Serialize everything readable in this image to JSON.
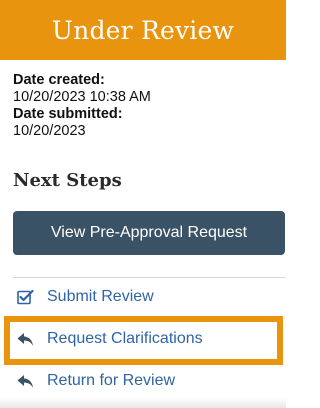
{
  "status": {
    "title": "Under Review",
    "color": "#e8940e"
  },
  "dates": {
    "created_label": "Date created:",
    "created_value": "10/20/2023 10:38 AM",
    "submitted_label": "Date submitted:",
    "submitted_value": "10/20/2023"
  },
  "next_steps": {
    "heading": "Next Steps",
    "primary_button_label": "View Pre-Approval Request",
    "primary_button_color": "#3a5265"
  },
  "actions": [
    {
      "label": "Submit Review",
      "icon": "checkbox-edit-icon"
    },
    {
      "label": "Request Clarifications",
      "icon": "reply-arrow-icon",
      "highlighted": true
    },
    {
      "label": "Return for Review",
      "icon": "reply-arrow-icon"
    }
  ],
  "colors": {
    "link": "#2f64a6",
    "highlight": "#e8940e"
  }
}
